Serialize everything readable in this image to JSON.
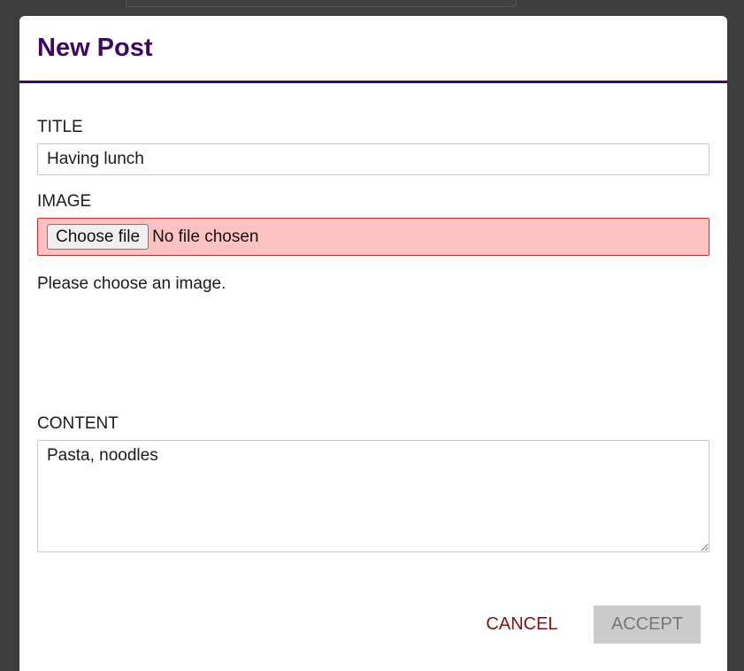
{
  "modal": {
    "title": "New Post"
  },
  "form": {
    "title_label": "TITLE",
    "title_value": "Having lunch",
    "image_label": "IMAGE",
    "file_button_label": "Choose file",
    "file_status": "No file chosen",
    "image_error": "Please choose an image.",
    "content_label": "CONTENT",
    "content_value": "Pasta, noodles"
  },
  "actions": {
    "cancel_label": "CANCEL",
    "accept_label": "ACCEPT"
  },
  "colors": {
    "accent": "#3d0a5f",
    "error_background": "#ffc2c2",
    "error_border": "#c92a2a",
    "cancel_text": "#8b0f0f",
    "disabled_button": "#cccccc"
  }
}
